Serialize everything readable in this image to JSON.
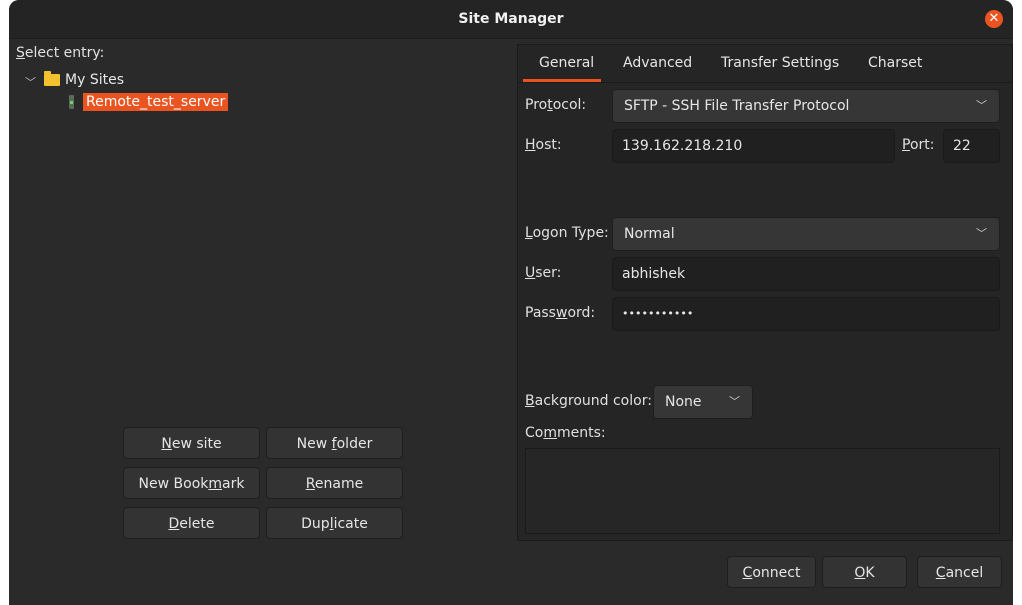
{
  "window": {
    "title": "Site Manager",
    "close_icon": "close-icon"
  },
  "left": {
    "select_entry_label": [
      "S",
      "elect entry:"
    ],
    "tree": {
      "folder": {
        "label": "My Sites",
        "icon": "folder-icon",
        "expanded": true
      },
      "site": {
        "label": "Remote_test_server",
        "icon": "server-icon",
        "selected": true
      }
    },
    "buttons": [
      {
        "pre": "",
        "ul": "N",
        "post": "ew site"
      },
      {
        "pre": "New ",
        "ul": "f",
        "post": "older"
      },
      {
        "pre": "New Book",
        "ul": "m",
        "post": "ark"
      },
      {
        "pre": "",
        "ul": "R",
        "post": "ename"
      },
      {
        "pre": "",
        "ul": "D",
        "post": "elete"
      },
      {
        "pre": "Dup",
        "ul": "l",
        "post": "icate"
      }
    ]
  },
  "tabs": [
    "General",
    "Advanced",
    "Transfer Settings",
    "Charset"
  ],
  "active_tab": "General",
  "accent_color": "#e95420",
  "general": {
    "protocol_label": [
      "Pro",
      "t",
      "ocol:"
    ],
    "protocol_value": "SFTP - SSH File Transfer Protocol",
    "host_label": [
      "",
      "H",
      "ost:"
    ],
    "host_value": "139.162.218.210",
    "port_label": [
      "",
      "P",
      "ort:"
    ],
    "port_value": "22",
    "logon_label": [
      "",
      "L",
      "ogon Type:"
    ],
    "logon_value": "Normal",
    "user_label": [
      "",
      "U",
      "ser:"
    ],
    "user_value": "abhishek",
    "password_label": [
      "Pass",
      "w",
      "ord:"
    ],
    "password_value": "•••••••••••",
    "bgcolor_label": [
      "",
      "B",
      "ackground color:"
    ],
    "bgcolor_value": "None",
    "comments_label": [
      "Co",
      "m",
      "ments:"
    ],
    "comments_value": ""
  },
  "footer": {
    "buttons": [
      {
        "pre": "",
        "ul": "C",
        "post": "onnect"
      },
      {
        "pre": "",
        "ul": "O",
        "post": "K"
      },
      {
        "pre": "",
        "ul": "C",
        "post": "ancel"
      }
    ]
  }
}
